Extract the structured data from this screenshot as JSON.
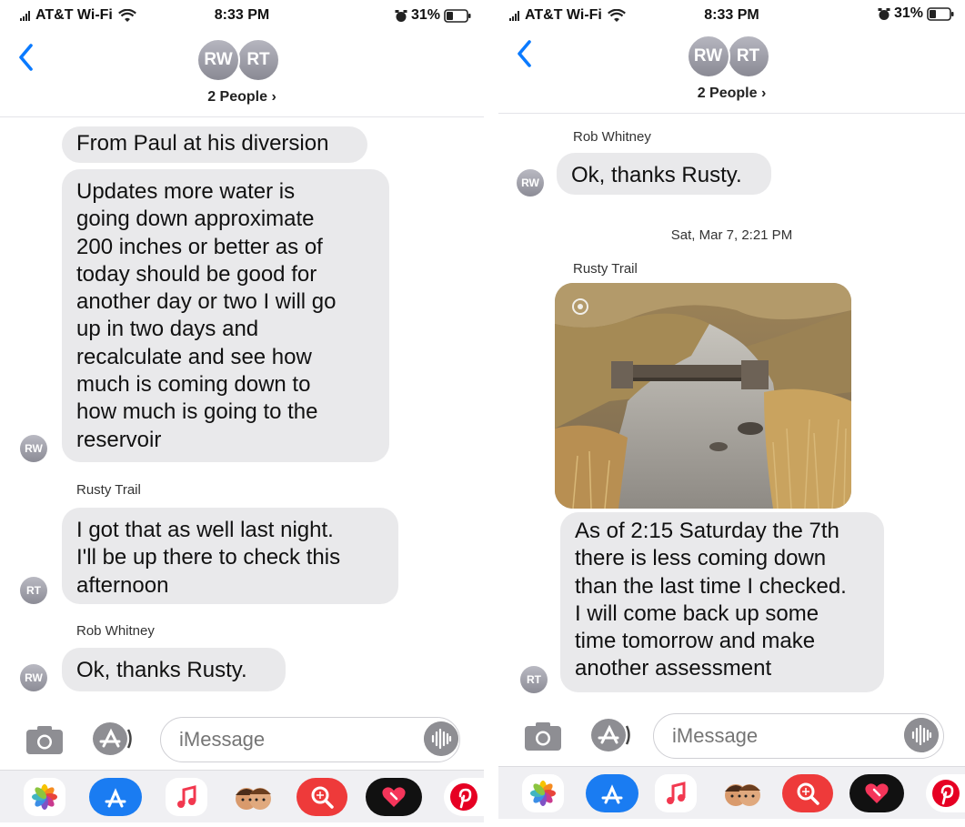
{
  "status_bar": {
    "carrier": "AT&T Wi-Fi",
    "time": "8:33 PM",
    "battery": "31%"
  },
  "header": {
    "avatars": [
      "RW",
      "RT"
    ],
    "people_label": "2 People ›"
  },
  "left": {
    "messages": [
      "From Paul at his diversion",
      "Updates more water is\ngoing down approximate\n200 inches or better as of\ntoday should be good for\nanother day or two I will go\nup in two days and\nrecalculate and see how\nmuch is coming down to\nhow much is going to the\nreservoir",
      "I got that as well last night.\nI'll be up there to check this\nafternoon",
      "Ok, thanks Rusty."
    ],
    "senders": [
      "Rusty Trail",
      "Rob Whitney"
    ],
    "avatars": [
      "RW",
      "RT",
      "RW"
    ]
  },
  "right": {
    "sender_top": "Rob Whitney",
    "message_top": "Ok, thanks Rusty.",
    "avatar_top": "RW",
    "timestamp": "Sat, Mar 7, 2:21 PM",
    "sender_bottom": "Rusty Trail",
    "message_bottom": "As of 2:15 Saturday the 7th\nthere is less coming down\nthan the last time I checked.\nI will come back up some\ntime tomorrow and make\nanother assessment",
    "avatar_bottom": "RT"
  },
  "input": {
    "placeholder": "iMessage"
  },
  "icons": {
    "camera": "camera-icon",
    "app_store": "app-store-icon",
    "audio": "audio-waveform-icon",
    "photos": "photos-app-icon",
    "music": "music-app-icon",
    "memoji": "memoji-app-icon",
    "image_search": "image-search-app-icon",
    "digital_touch": "digital-touch-app-icon",
    "pinterest": "pinterest-app-icon"
  },
  "colors": {
    "accent_blue": "#0a7aff",
    "bubble_gray": "#e9e9eb"
  }
}
